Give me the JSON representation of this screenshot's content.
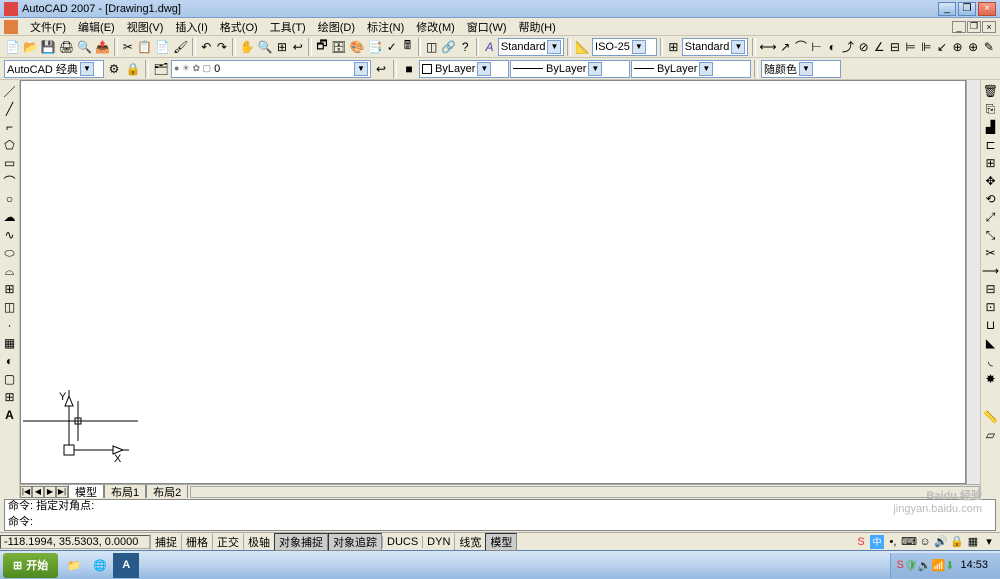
{
  "title": "AutoCAD 2007 - [Drawing1.dwg]",
  "menu": {
    "file": "文件(F)",
    "edit": "编辑(E)",
    "view": "视图(V)",
    "insert": "插入(I)",
    "format": "格式(O)",
    "tools": "工具(T)",
    "draw": "绘图(D)",
    "dimension": "标注(N)",
    "modify": "修改(M)",
    "window": "窗口(W)",
    "help": "帮助(H)"
  },
  "workspace": {
    "value": "AutoCAD 经典"
  },
  "layer": {
    "value": "0",
    "layer_icons": "● ☀ ✿ ▢"
  },
  "bylayer1": "ByLayer",
  "bylayer2": "ByLayer",
  "bylayer3": "ByLayer",
  "textstyle": "Standard",
  "dimstyle": "ISO-25",
  "tablestyle": "Standard",
  "followcolor": "随颜色",
  "left_tools": [
    "line-icon",
    "xline-icon",
    "polyline-icon",
    "polygon-icon",
    "rectangle-icon",
    "arc-icon",
    "circle-icon",
    "revcloud-icon",
    "spline-icon",
    "ellipse-icon",
    "ellipsearc-icon",
    "insert-icon",
    "block-icon",
    "point-icon",
    "hatch-icon",
    "gradient-icon",
    "region-icon",
    "table-icon",
    "mtext-icon"
  ],
  "right_tools": [
    "erase-icon",
    "copy-icon",
    "mirror-icon",
    "offset-icon",
    "array-icon",
    "move-icon",
    "rotate-icon",
    "scale-icon",
    "stretch-icon",
    "trim-icon",
    "extend-icon",
    "break-icon",
    "breakat-icon",
    "join-icon",
    "chamfer-icon",
    "fillet-icon",
    "explode-icon"
  ],
  "right_tools2": [
    "distance-icon",
    "area-icon",
    "region-icon",
    "list-icon",
    "id-icon"
  ],
  "tabs": {
    "model": "模型",
    "layout1": "布局1",
    "layout2": "布局2"
  },
  "cmd": {
    "line1": "命令: 指定对角点:",
    "prompt": "命令:"
  },
  "status": {
    "coord": "-118.1994, 35.5303, 0.0000",
    "snap": "捕捉",
    "grid": "栅格",
    "ortho": "正交",
    "polar": "极轴",
    "osnap": "对象捕捉",
    "otrack": "对象追踪",
    "ducs": "DUCS",
    "dyn": "DYN",
    "lwt": "线宽",
    "model": "模型"
  },
  "taskbar": {
    "start": "开始",
    "time": "14:53"
  },
  "watermark": {
    "main": "Baidu 经验",
    "sub": "jingyan.baidu.com"
  },
  "icons": {
    "min": "_",
    "max": "❐",
    "close": "×",
    "dropdown": "▼",
    "first": "|◀",
    "prev": "◀",
    "next": "▶",
    "last": "▶|"
  }
}
